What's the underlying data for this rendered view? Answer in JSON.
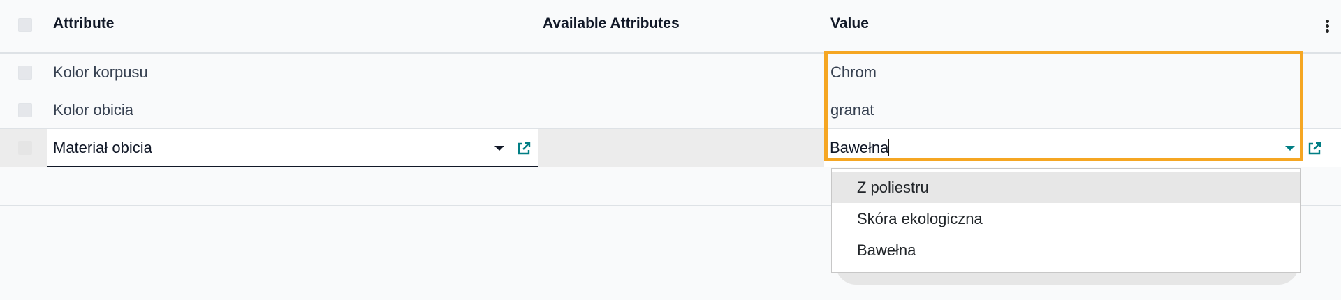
{
  "table": {
    "headers": {
      "attribute": "Attribute",
      "available_attributes": "Available Attributes",
      "value": "Value"
    },
    "rows": [
      {
        "attribute": "Kolor korpusu",
        "available_attributes": "",
        "value": "Chrom"
      },
      {
        "attribute": "Kolor obicia",
        "available_attributes": "",
        "value": "granat"
      }
    ],
    "edit_row": {
      "attribute_value": "Materiał obicia",
      "value_input": "Bawełna"
    }
  },
  "dropdown": {
    "options": [
      "Z poliestru",
      "Skóra ekologiczna",
      "Bawełna"
    ],
    "highlighted": "Z poliestru"
  },
  "colors": {
    "highlight_border": "#f5a623",
    "accent": "#017e84"
  },
  "icons": {
    "kebab": "vertical-ellipsis-icon",
    "external": "external-link-icon",
    "caret": "caret-down-icon"
  }
}
